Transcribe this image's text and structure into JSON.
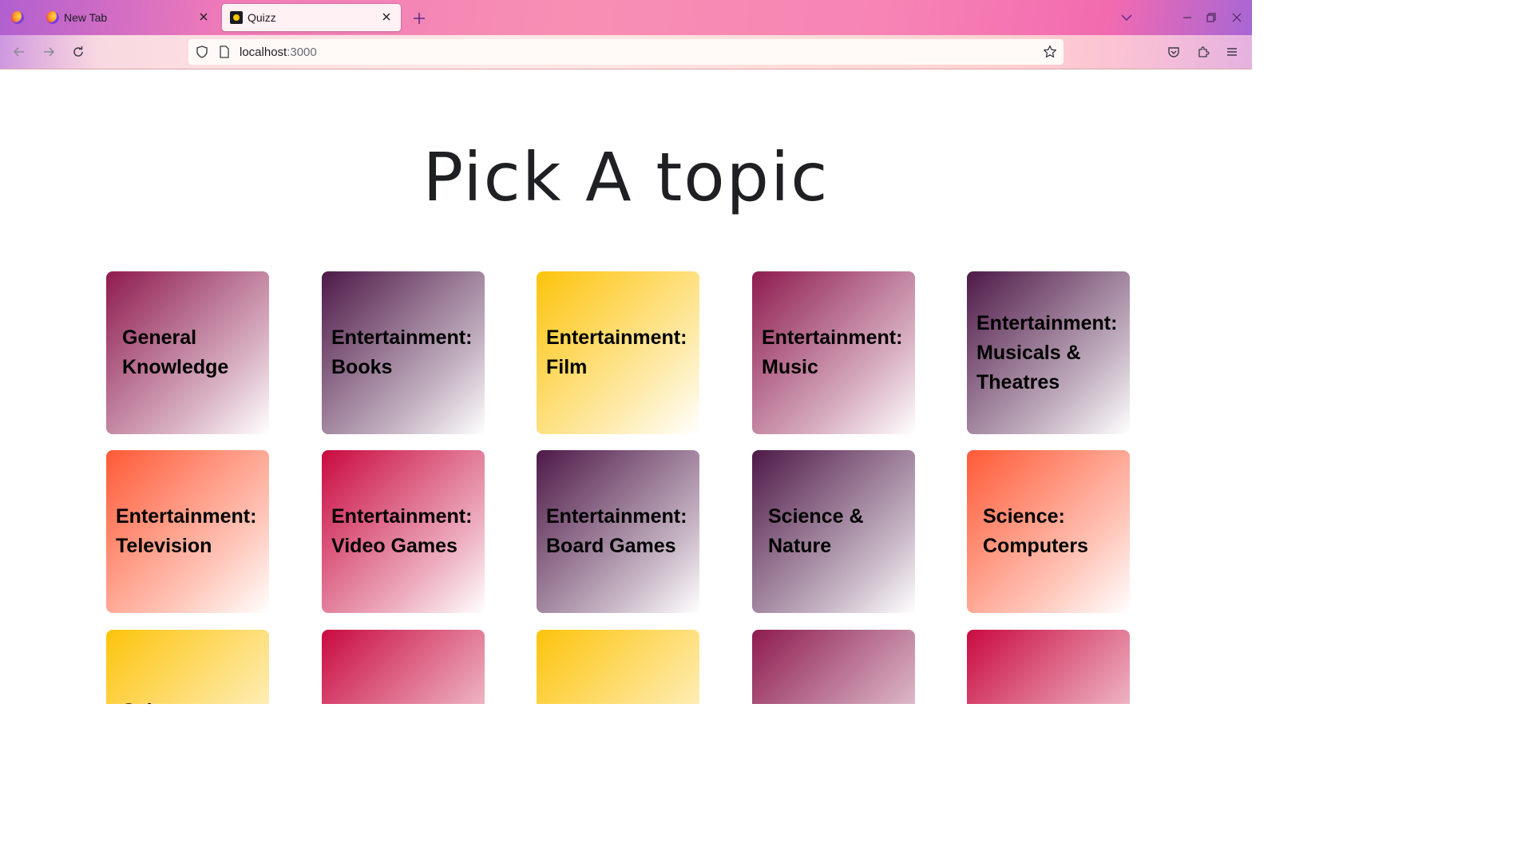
{
  "browser": {
    "tabs": [
      {
        "title": "New Tab",
        "active": false
      },
      {
        "title": "Quizz",
        "active": true
      }
    ],
    "url_host": "localhost",
    "url_port": ":3000",
    "icons": {
      "firefox_menu": "firefox-logo-icon",
      "close": "close-icon",
      "new_tab": "plus-icon",
      "tab_list": "chevron-down-icon",
      "back": "back-arrow-icon",
      "forward": "forward-arrow-icon",
      "reload": "reload-icon",
      "shield": "tracking-protection-icon",
      "page": "page-icon",
      "bookmark": "star-icon",
      "pocket": "pocket-icon",
      "extensions": "puzzle-icon",
      "menu": "hamburger-menu-icon"
    }
  },
  "page": {
    "heading": "Pick A topic",
    "topics": [
      {
        "label": "General Knowledge",
        "color": "#8e1b4f"
      },
      {
        "label": "Entertainment: Books",
        "color": "#4e1948"
      },
      {
        "label": "Entertainment: Film",
        "color": "#fdc40c"
      },
      {
        "label": "Entertainment: Music",
        "color": "#8e1b4f"
      },
      {
        "label": "Entertainment: Musicals & Theatres",
        "color": "#4e1948"
      },
      {
        "label": "Entertainment: Television",
        "color": "#ff5a36"
      },
      {
        "label": "Entertainment: Video Games",
        "color": "#c90a3f"
      },
      {
        "label": "Entertainment: Board Games",
        "color": "#4e1948"
      },
      {
        "label": "Science & Nature",
        "color": "#4e1948"
      },
      {
        "label": "Science: Computers",
        "color": "#ff5a36"
      },
      {
        "label": "Science:",
        "color": "#fdc40c"
      },
      {
        "label": "",
        "color": "#c90a3f"
      },
      {
        "label": "",
        "color": "#fdc40c"
      },
      {
        "label": "",
        "color": "#8e1b4f"
      },
      {
        "label": "",
        "color": "#c90a3f"
      }
    ]
  }
}
